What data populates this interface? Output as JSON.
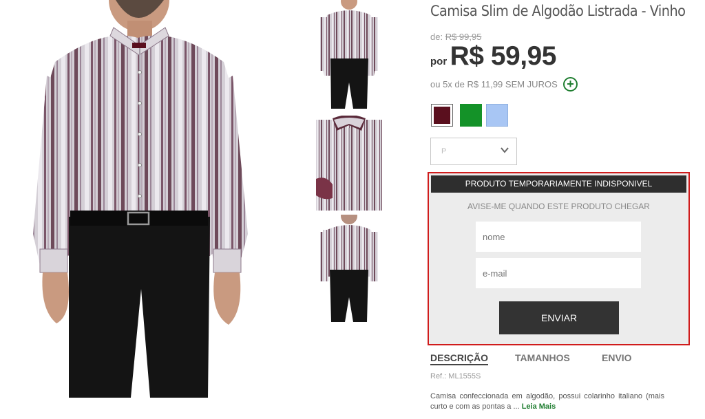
{
  "product": {
    "title": "Camisa Slim de Algodão Listrada - Vinho",
    "old_price_prefix": "de:",
    "old_price": "R$ 99,95",
    "price_prefix": "por",
    "price": "R$ 59,95",
    "installments": "ou 5x de R$ 11,99 SEM JUROS",
    "installments_icon": "plus-circle-icon"
  },
  "colors": [
    {
      "name": "vinho",
      "hex": "#5a0f1e",
      "selected": true
    },
    {
      "name": "verde",
      "hex": "#149228",
      "selected": false
    },
    {
      "name": "azul",
      "hex": "#a8c6f4",
      "selected": false
    }
  ],
  "size_select": {
    "value": "P",
    "icon": "chevron-down-icon"
  },
  "notify": {
    "header": "PRODUTO TEMPORARIAMENTE INDISPONIVEL",
    "subtitle": "AVISE-ME QUANDO ESTE PRODUTO CHEGAR",
    "name_placeholder": "nome",
    "email_placeholder": "e-mail",
    "button": "ENVIAR",
    "border_color": "#d01c1c"
  },
  "tabs": [
    {
      "label": "DESCRIÇÃO",
      "active": true
    },
    {
      "label": "TAMANHOS",
      "active": false
    },
    {
      "label": "ENVIO",
      "active": false
    }
  ],
  "description": {
    "ref": "Ref.: ML1555S",
    "text": "Camisa confeccionada em algodão, possui colarinho italiano (mais curto e com as pontas a ...",
    "more_link": "Leia Mais"
  },
  "accent_color": "#1e7d2f"
}
